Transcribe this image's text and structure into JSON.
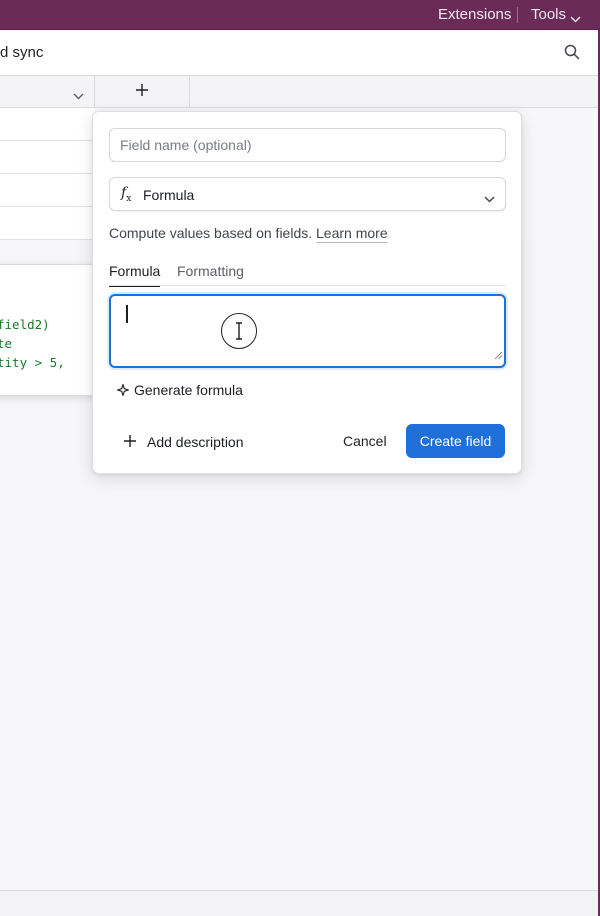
{
  "topbar": {
    "extensions_label": "Extensions",
    "tools_label": "Tools"
  },
  "toolbar": {
    "title_fragment": "d sync"
  },
  "code_popup": {
    "lines": [
      "field2)",
      "te",
      "tity > 5,"
    ]
  },
  "dialog": {
    "field_name_placeholder": "Field name (optional)",
    "field_name_value": "",
    "field_type": "Formula",
    "field_type_icon": "f",
    "field_type_icon_sub": "x",
    "description_text": "Compute values based on fields.",
    "learn_more": "Learn more",
    "tabs": [
      {
        "label": "Formula",
        "active": true
      },
      {
        "label": "Formatting",
        "active": false
      }
    ],
    "formula_value": "",
    "generate_label": "Generate formula",
    "add_description_label": "Add description",
    "cancel_label": "Cancel",
    "create_label": "Create field"
  },
  "colors": {
    "topbar": "#6b2b59",
    "accent": "#1f6fd9",
    "code_green": "#1b7a2c"
  }
}
